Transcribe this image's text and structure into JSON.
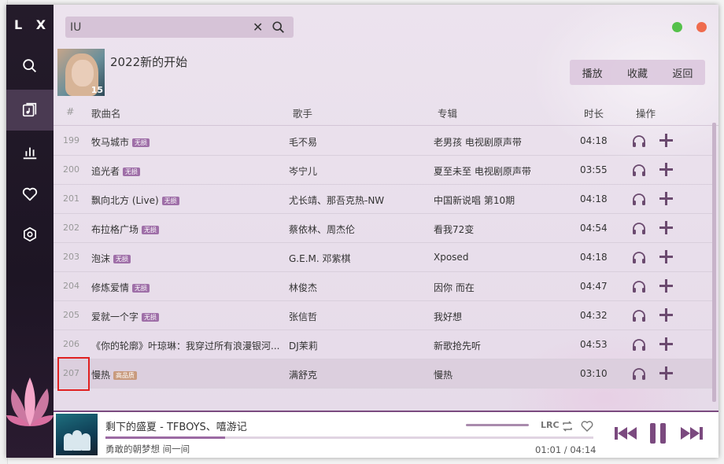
{
  "app": {
    "logo": "L X"
  },
  "sidebar": {
    "items": [
      {
        "name": "search",
        "icon": "search-icon"
      },
      {
        "name": "songlist",
        "icon": "music-list-icon"
      },
      {
        "name": "leaderboard",
        "icon": "chart-bar-icon"
      },
      {
        "name": "favorites",
        "icon": "heart-icon"
      },
      {
        "name": "settings",
        "icon": "settings-icon"
      }
    ]
  },
  "search": {
    "value": "IU"
  },
  "playlist": {
    "title": "2022新的开始",
    "count": "15",
    "actions": {
      "play": "播放",
      "collect": "收藏",
      "back": "返回"
    }
  },
  "table": {
    "headers": {
      "index": "#",
      "name": "歌曲名",
      "artist": "歌手",
      "album": "专辑",
      "duration": "时长",
      "ops": "操作"
    },
    "rows": [
      {
        "index": "199",
        "name": "牧马城市",
        "tag": "无损",
        "artist": "毛不易",
        "album": "老男孩 电视剧原声带",
        "duration": "04:18"
      },
      {
        "index": "200",
        "name": "追光者",
        "tag": "无损",
        "artist": "岑宁儿",
        "album": "夏至未至 电视剧原声带",
        "duration": "03:55"
      },
      {
        "index": "201",
        "name": "飘向北方 (Live)",
        "tag": "无损",
        "artist": "尤长靖、那吾克热-NW",
        "album": "中国新说唱 第10期",
        "duration": "04:18"
      },
      {
        "index": "202",
        "name": "布拉格广场",
        "tag": "无损",
        "artist": "蔡依林、周杰伦",
        "album": "看我72变",
        "duration": "04:54"
      },
      {
        "index": "203",
        "name": "泡沫",
        "tag": "无损",
        "artist": "G.E.M. 邓紫棋",
        "album": "Xposed",
        "duration": "04:18"
      },
      {
        "index": "204",
        "name": "修炼爱情",
        "tag": "无损",
        "artist": "林俊杰",
        "album": "因你 而在",
        "duration": "04:47"
      },
      {
        "index": "205",
        "name": "爱就一个字",
        "tag": "无损",
        "artist": "张信哲",
        "album": "我好想",
        "duration": "04:32"
      },
      {
        "index": "206",
        "name": "《你的轮廓》叶琼琳：我穿过所有浪漫银河...",
        "tag": "",
        "artist": "DJ茉莉",
        "album": "新歌抢先听",
        "duration": "04:53"
      },
      {
        "index": "207",
        "name": "慢热",
        "tag": "高品质",
        "artist": "满舒克",
        "album": "慢热",
        "duration": "03:10"
      }
    ]
  },
  "player": {
    "title": "剩下的盛夏 - TFBOYS、嘻游记",
    "album": "勇敢的朝梦想 间一间",
    "current_time": "01:01",
    "total_time": "04:14",
    "time_display": "01:01 / 04:14",
    "progress": 0.245,
    "lrc": "LRC"
  },
  "colors": {
    "accent": "#7b4a7f",
    "sidebar": "#241b2a",
    "tag": "#9f6fa8",
    "tag_hq": "#c89a7d"
  }
}
